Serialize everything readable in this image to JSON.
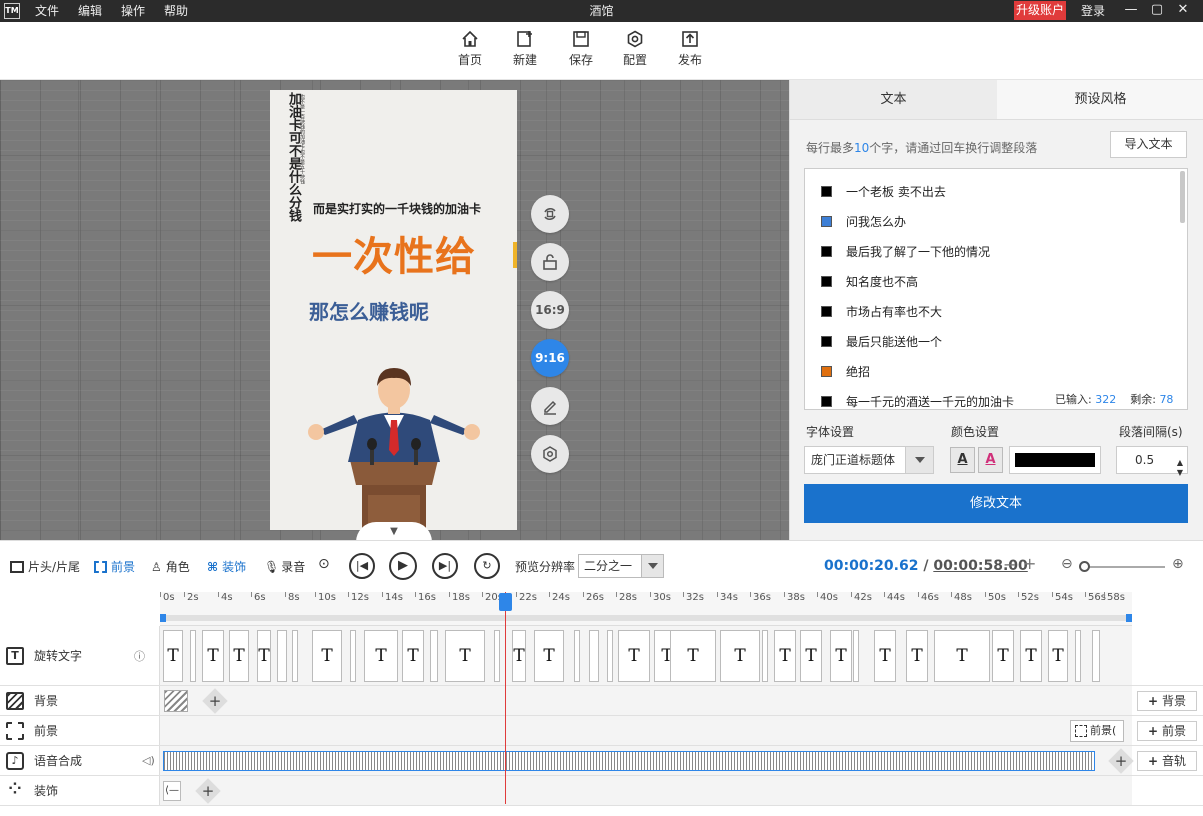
{
  "titlebar": {
    "logo": "TM",
    "menu": [
      "文件",
      "编辑",
      "操作",
      "帮助"
    ],
    "title": "酒馆",
    "upgrade": "升级账户",
    "login": "登录"
  },
  "toolbar": {
    "home": "首页",
    "new": "新建",
    "save": "保存",
    "config": "配置",
    "publish": "发布"
  },
  "canvas": {
    "vertical_text": "加油卡可不是什么分钱",
    "vertical_small": "也不是一百块钱的加油卡也不是五十块钱",
    "line1": "而是实打实的一千块钱的加油卡",
    "big": "一次性给",
    "sub": "那怎么赚钱呢"
  },
  "side_buttons": {
    "ratio_169": "16:9",
    "ratio_916": "9:16"
  },
  "panel": {
    "tab_text": "文本",
    "tab_style": "预设风格",
    "hint_pre": "每行最多",
    "hint_num": "10",
    "hint_post": "个字，请通过回车换行调整段落",
    "import": "导入文本",
    "items": [
      {
        "text": "一个老板  卖不出去",
        "color": "#000000"
      },
      {
        "text": "问我怎么办",
        "color": "#3d7fd6"
      },
      {
        "text": "最后我了解了一下他的情况",
        "color": "#000000"
      },
      {
        "text": "知名度也不高",
        "color": "#000000"
      },
      {
        "text": "市场占有率也不大",
        "color": "#000000"
      },
      {
        "text": "最后只能送他一个",
        "color": "#000000"
      },
      {
        "text": "绝招",
        "color": "#e0700f"
      },
      {
        "text": "每一千元的酒送一千元的加油卡",
        "color": "#000000"
      }
    ],
    "entered_label": "已输入:",
    "entered": "322",
    "remain_label": "剩余:",
    "remain": "78",
    "font_label": "字体设置",
    "color_label": "颜色设置",
    "spacing_label": "段落间隔(s)",
    "font_value": "庞门正道标题体",
    "color_value": "#000000",
    "spacing_value": "0.5",
    "modify": "修改文本"
  },
  "controls": {
    "head_tail": "片头/片尾",
    "foreground": "前景",
    "role": "角色",
    "decor": "装饰",
    "record": "录音",
    "resolution_label": "预览分辨率",
    "resolution_value": "二分之一",
    "current_time": "00:00:20.62",
    "separator": "/",
    "total_time": "00:00:58.00"
  },
  "ruler": [
    "0s",
    "2s",
    "4s",
    "6s",
    "8s",
    "10s",
    "12s",
    "14s",
    "16s",
    "18s",
    "20s",
    "22s",
    "24s",
    "26s",
    "28s",
    "30s",
    "32s",
    "34s",
    "36s",
    "38s",
    "40s",
    "42s",
    "44s",
    "46s",
    "48s",
    "50s",
    "52s",
    "54s",
    "56s",
    "58s"
  ],
  "tracks": {
    "rotate_text": "旋转文字",
    "background": "背景",
    "foreground": "前景",
    "voice": "语音合成",
    "decor": "装饰",
    "add_background": "背景",
    "add_foreground": "前景",
    "add_track": "音轨",
    "fg_clip": "前景("
  },
  "clip_letter": "T"
}
